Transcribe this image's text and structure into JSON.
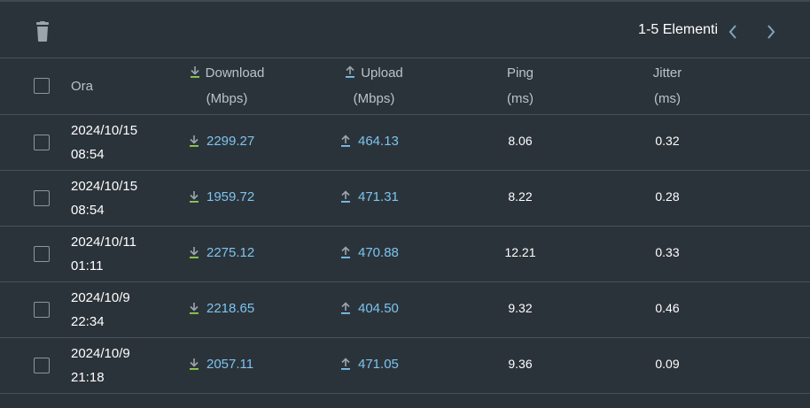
{
  "toolbar": {
    "delete_icon": "trash-icon",
    "pager_label": "1-5 Elementi",
    "prev_icon": "chevron-left-icon",
    "next_icon": "chevron-right-icon"
  },
  "columns": {
    "time": "Ora",
    "download": {
      "label": "Download",
      "unit": "(Mbps)",
      "icon": "download-arrow-icon"
    },
    "upload": {
      "label": "Upload",
      "unit": "(Mbps)",
      "icon": "upload-arrow-icon"
    },
    "ping": {
      "label": "Ping",
      "unit": "(ms)"
    },
    "jitter": {
      "label": "Jitter",
      "unit": "(ms)"
    }
  },
  "rows": [
    {
      "date": "2024/10/15",
      "time": "08:54",
      "download": "2299.27",
      "upload": "464.13",
      "ping": "8.06",
      "jitter": "0.32"
    },
    {
      "date": "2024/10/15",
      "time": "08:54",
      "download": "1959.72",
      "upload": "471.31",
      "ping": "8.22",
      "jitter": "0.28"
    },
    {
      "date": "2024/10/11",
      "time": "01:11",
      "download": "2275.12",
      "upload": "470.88",
      "ping": "12.21",
      "jitter": "0.33"
    },
    {
      "date": "2024/10/9",
      "time": "22:34",
      "download": "2218.65",
      "upload": "404.50",
      "ping": "9.32",
      "jitter": "0.46"
    },
    {
      "date": "2024/10/9",
      "time": "21:18",
      "download": "2057.11",
      "upload": "471.05",
      "ping": "9.36",
      "jitter": "0.09"
    }
  ],
  "colors": {
    "background": "#2b333a",
    "link_value": "#7cc4ee",
    "download_icon": "#8fd14f",
    "upload_icon": "#7cc4ee",
    "icon_gray": "#9aa5ae"
  }
}
